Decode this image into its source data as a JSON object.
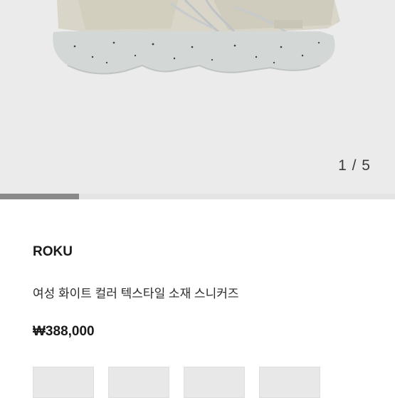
{
  "gallery": {
    "counter": "1 / 5",
    "image_alt": "sneaker",
    "progress": 0.2,
    "thumbnail_count": 4
  },
  "product": {
    "brand": "ROKU",
    "name": "여성 화이트 컬러 텍스타일 소재 스니커즈",
    "price": "₩388,000"
  }
}
